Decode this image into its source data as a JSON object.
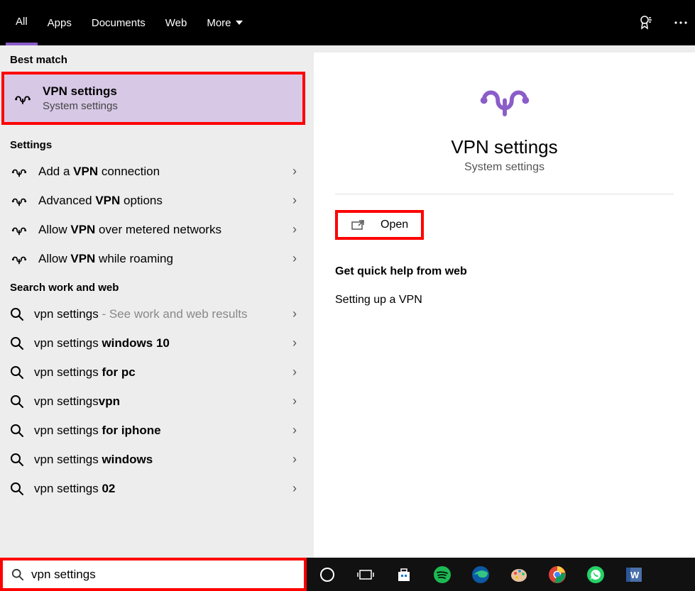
{
  "tabs": {
    "all": "All",
    "apps": "Apps",
    "documents": "Documents",
    "web": "Web",
    "more": "More"
  },
  "sections": {
    "best_match": "Best match",
    "settings": "Settings",
    "search_web": "Search work and web"
  },
  "best_match": {
    "title": "VPN settings",
    "subtitle": "System settings"
  },
  "settings_items": {
    "s1_pre": "Add a ",
    "s1_bold": "VPN",
    "s1_post": " connection",
    "s2_pre": "Advanced ",
    "s2_bold": "VPN",
    "s2_post": " options",
    "s3_pre": "Allow ",
    "s3_bold": "VPN",
    "s3_post": " over metered networks",
    "s4_pre": "Allow ",
    "s4_bold": "VPN",
    "s4_post": " while roaming"
  },
  "web_items": {
    "w1_a": "vpn settings",
    "w1_muted": " - See work and web results",
    "w2_a": "vpn settings ",
    "w2_b": "windows 10",
    "w3_a": "vpn settings ",
    "w3_b": "for pc",
    "w4_a": "vpn settings",
    "w4_b": "vpn",
    "w5_a": "vpn settings ",
    "w5_b": "for iphone",
    "w6_a": "vpn settings ",
    "w6_b": "windows",
    "w7_a": "vpn settings ",
    "w7_b": "02"
  },
  "right": {
    "title": "VPN settings",
    "subtitle": "System settings",
    "open": "Open",
    "help_header": "Get quick help from web",
    "help_link": "Setting up a VPN"
  },
  "search": {
    "value": "vpn settings"
  }
}
